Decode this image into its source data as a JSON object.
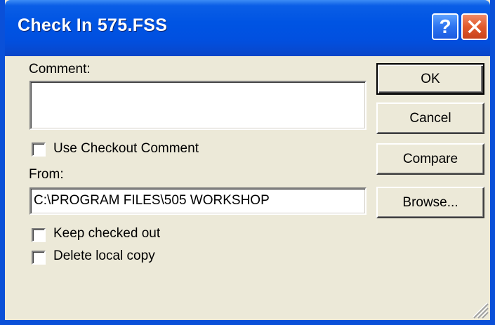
{
  "window": {
    "title": "Check In 575.FSS",
    "help_glyph": "?",
    "colors": {
      "titlebar": "#0054e3",
      "face": "#ece9d8",
      "close": "#e15a2c"
    }
  },
  "form": {
    "comment_label": "Comment:",
    "comment_value": "",
    "use_checkout_comment_label": "Use Checkout Comment",
    "from_label": "From:",
    "from_value": "C:\\PROGRAM FILES\\505 WORKSHOP",
    "keep_checked_out_label": "Keep checked out",
    "delete_local_copy_label": "Delete local copy"
  },
  "checkboxes": {
    "use_checkout_comment": false,
    "keep_checked_out": false,
    "delete_local_copy": false
  },
  "buttons": {
    "ok": "OK",
    "cancel": "Cancel",
    "compare": "Compare",
    "browse": "Browse..."
  }
}
